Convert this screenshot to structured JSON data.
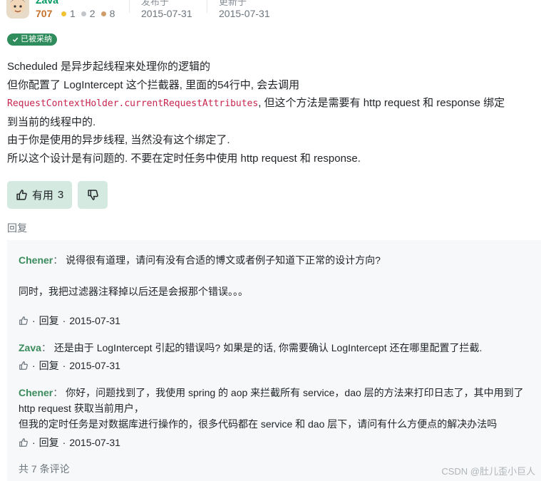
{
  "author": {
    "name": "Zava",
    "reputation": "707",
    "badges": [
      {
        "count": "1",
        "color": "#f1c232"
      },
      {
        "count": "2",
        "color": "#c2c6ca"
      },
      {
        "count": "8",
        "color": "#d09c6a"
      }
    ],
    "published_label": "发布于",
    "published_date": "2015-07-31",
    "updated_label": "更新于",
    "updated_date": "2015-07-31"
  },
  "accepted_label": "已被采纳",
  "answer": {
    "line1": "Scheduled 是异步起线程来处理你的逻辑的",
    "line2": "但你配置了 LogIntercept 这个拦截器, 里面的54行中, 会去调用",
    "code": "RequestContextHolder.currentRequestAttributes",
    "line3_rest": ", 但这个方法是需要有 http request 和 response 绑定",
    "line4": "到当前的线程中的.",
    "line5": "由于你是使用的异步线程, 当然没有这个绑定了.",
    "line6": "所以这个设计是有问题的. 不要在定时任务中使用 http request 和 response."
  },
  "vote": {
    "useful_label": "有用",
    "useful_count": "3"
  },
  "reply_label": "回复",
  "comments": [
    {
      "user": "Chener",
      "colon": "：",
      "lines": [
        "说得很有道理，请问有没有合适的博文或者例子知道下正常的设计方向?",
        "同时，我把过滤器注释掉以后还是会报那个错误。。。"
      ],
      "reply": "回复",
      "date": "2015-07-31"
    },
    {
      "user": "Zava",
      "colon": "：",
      "lines": [
        "还是由于 LogIntercept 引起的错误吗? 如果是的话, 你需要确认 LogIntercept 还在哪里配置了拦截."
      ],
      "reply": "回复",
      "date": "2015-07-31"
    },
    {
      "user": "Chener",
      "colon": "：",
      "lines": [
        "你好，问题找到了，我使用 spring 的 aop 来拦截所有 service，dao 层的方法来打印日志了，其中用到了",
        "http request 获取当前用户，",
        "但我的定时任务是对数据库进行操作的，很多代码都在 service 和 dao 层下，请问有什么方便点的解决办法吗"
      ],
      "reply": "回复",
      "date": "2015-07-31"
    }
  ],
  "comment_total": "共 7 条评论",
  "watermark": "CSDN @肚儿歪小巨人"
}
